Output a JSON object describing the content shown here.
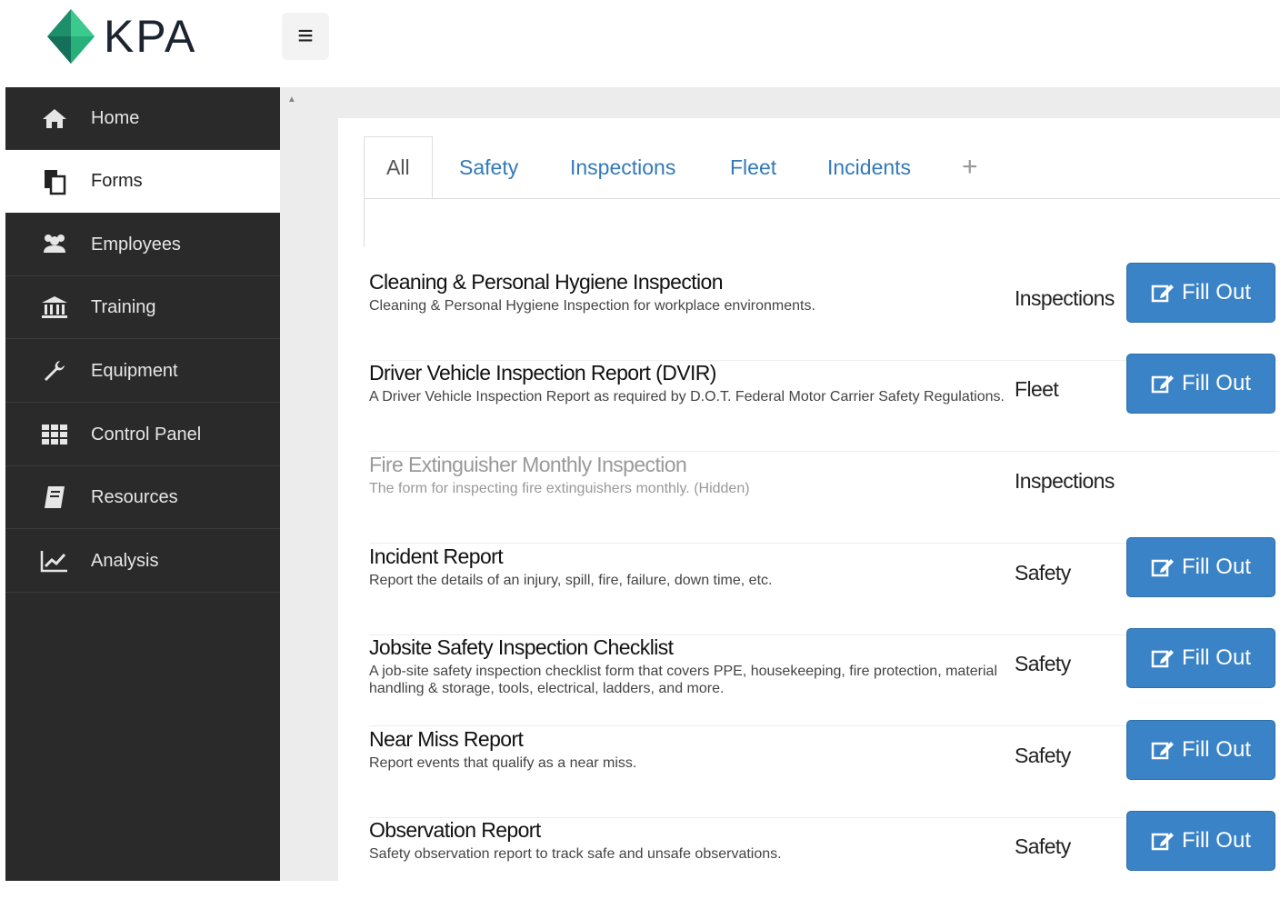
{
  "header": {
    "logo_text": "KPA",
    "menu_icon": "hamburger-icon"
  },
  "sidebar": {
    "items": [
      {
        "label": "Home",
        "icon": "home-icon"
      },
      {
        "label": "Forms",
        "icon": "forms-icon",
        "active": true
      },
      {
        "label": "Employees",
        "icon": "employees-icon"
      },
      {
        "label": "Training",
        "icon": "training-icon"
      },
      {
        "label": "Equipment",
        "icon": "wrench-icon"
      },
      {
        "label": "Control Panel",
        "icon": "grid-icon"
      },
      {
        "label": "Resources",
        "icon": "book-icon"
      },
      {
        "label": "Analysis",
        "icon": "chart-icon"
      }
    ]
  },
  "tabs": {
    "items": [
      {
        "label": "All",
        "active": true
      },
      {
        "label": "Safety"
      },
      {
        "label": "Inspections"
      },
      {
        "label": "Fleet"
      },
      {
        "label": "Incidents"
      }
    ],
    "add_label": "+"
  },
  "forms": [
    {
      "title": "Cleaning & Personal Hygiene Inspection",
      "description": "Cleaning & Personal Hygiene Inspection for workplace environments.",
      "category": "Inspections",
      "button": "Fill Out"
    },
    {
      "title": "Driver Vehicle Inspection Report (DVIR)",
      "description": "A Driver Vehicle Inspection Report as required by D.O.T. Federal Motor Carrier Safety Regulations.",
      "category": "Fleet",
      "button": "Fill Out"
    },
    {
      "title": "Fire Extinguisher Monthly Inspection",
      "description": "The form for inspecting fire extinguishers monthly. (Hidden)",
      "category": "Inspections",
      "hidden": true
    },
    {
      "title": "Incident Report",
      "description": "Report the details of an injury, spill, fire, failure, down time, etc.",
      "category": "Safety",
      "button": "Fill Out"
    },
    {
      "title": "Jobsite Safety Inspection Checklist",
      "description": "A job-site safety inspection checklist form that covers PPE, housekeeping, fire protection, material handling & storage, tools, electrical, ladders, and more.",
      "category": "Safety",
      "button": "Fill Out"
    },
    {
      "title": "Near Miss Report",
      "description": "Report events that qualify as a near miss.",
      "category": "Safety",
      "button": "Fill Out"
    },
    {
      "title": "Observation Report",
      "description": "Safety observation report to track safe and unsafe observations.",
      "category": "Safety",
      "button": "Fill Out"
    }
  ],
  "colors": {
    "accent": "#3a83c6",
    "sidebar_bg": "#2a2a2a",
    "link": "#337ab7",
    "logo_green": "#27b07a"
  }
}
